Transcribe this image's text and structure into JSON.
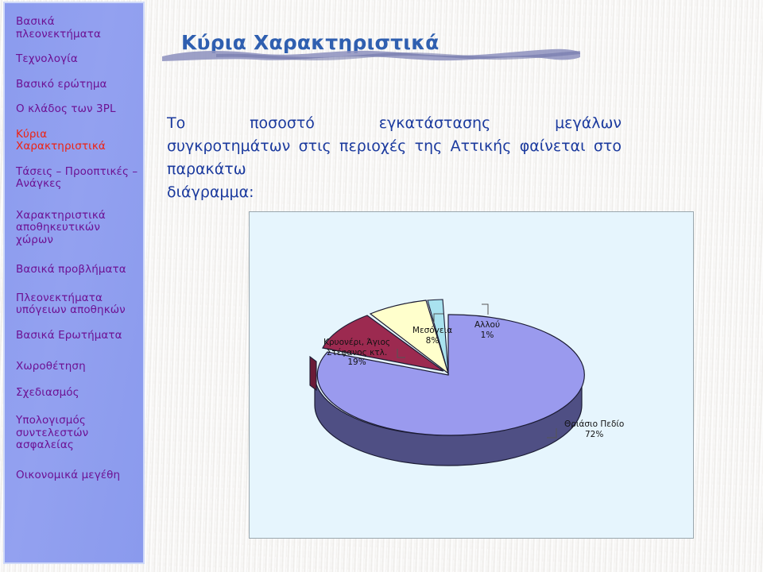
{
  "slide": {
    "title": "Κύρια Χαρακτηριστικά",
    "body_line1": "Το ποσοστό εγκατάστασης μεγάλων",
    "body_line2": "συγκροτημάτων στις περιοχές της Αττικής φαίνεται στο παρακάτω",
    "body_line3": "διάγραμμα:"
  },
  "sidebar": {
    "items": [
      {
        "label": "Βασικά πλεονεκτήματα",
        "active": false
      },
      {
        "label": "Τεχνολογία",
        "active": false
      },
      {
        "label": "Βασικό ερώτημα",
        "active": false
      },
      {
        "label": "Ο κλάδος των 3PL",
        "active": false
      },
      {
        "label": "Κύρια Χαρακτηριστικά",
        "active": true
      },
      {
        "label": "Τάσεις – Προοπτικές – Ανάγκες",
        "active": false
      },
      {
        "label": "Χαρακτηριστικά αποθηκευτικών χώρων",
        "active": false
      },
      {
        "label": "Βασικά προβλήματα",
        "active": false
      },
      {
        "label": "Πλεονεκτήματα υπόγειων αποθηκών",
        "active": false
      },
      {
        "label": "Βασικά Ερωτήματα",
        "active": false
      },
      {
        "label": "Χωροθέτηση",
        "active": false
      },
      {
        "label": "Σχεδιασμός",
        "active": false
      },
      {
        "label": "Υπολογισμός συντελεστών ασφαλείας",
        "active": false
      },
      {
        "label": "Οικονομικά μεγέθη",
        "active": false
      }
    ],
    "colors": {
      "background": "#8c9cee",
      "text": "#6d1193",
      "active_text": "#ee2211",
      "border": "#cfd9f8"
    }
  },
  "chart_data": {
    "type": "pie",
    "title": "",
    "style": "3d-exploded",
    "labels": [
      "Θριάσιο Πεδίο",
      "Κρυονέρι, Άγιος Στέφανος κτλ.",
      "Μεσόγεια",
      "Αλλού"
    ],
    "values": [
      72,
      19,
      8,
      1
    ],
    "value_unit": "%",
    "annotations": [
      {
        "text": "Κρυονέρι, Άγιος\nΣτέφανος κτλ.\n19%",
        "line1": "Κρυονέρι, Άγιος",
        "line2": "Στέφανος κτλ.",
        "line3": "19%"
      },
      {
        "text": "Μεσόγεια 8%",
        "line1": "Μεσόγεια",
        "line2": "8%"
      },
      {
        "text": "Αλλού 1%",
        "line1": "Αλλού",
        "line2": "1%"
      },
      {
        "text": "Θριάσιο Πεδίο 72%",
        "line1": "Θριάσιο Πεδίο",
        "line2": "72%"
      }
    ],
    "colors": {
      "thriasio_top": "#9a9aee",
      "thriasio_side": "#4f4f84",
      "kryoneri_top": "#9c2a50",
      "kryoneri_side": "#6b1b37",
      "mesogeia_top": "#ffffcc",
      "mesogeia_side": "#b3b38f",
      "allou_top": "#a9e2ef",
      "allou_side": "#76a3ad",
      "plot_background": "#e6f5fd",
      "plot_border": "#9aa7ae"
    },
    "legend": "none",
    "grid": false
  },
  "theme": {
    "title_color": "#2f5fb0",
    "body_color": "#1b3a9e",
    "page_background": "#f4f3f1",
    "wave_color": "#8f93bf"
  }
}
